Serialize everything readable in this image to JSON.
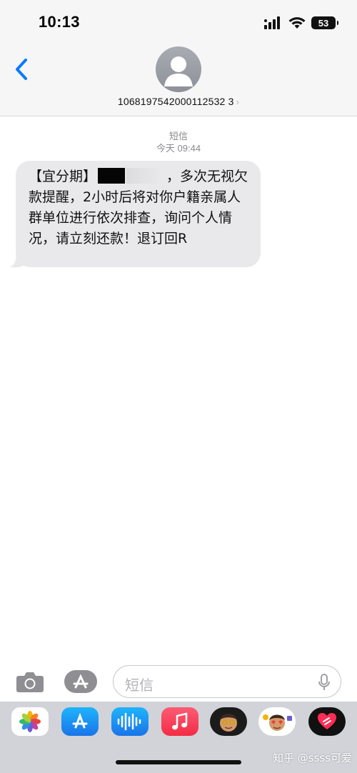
{
  "status_bar": {
    "time": "10:13",
    "battery_level": "53"
  },
  "header": {
    "contact_number": "1068197542000112532 3",
    "chevron": "›"
  },
  "thread": {
    "service_label": "短信",
    "timestamp": "今天 09:44",
    "message": {
      "part1": "【宜分期】",
      "part2": "，多次无视欠款提醒，2小时后将对你户籍亲属人群单位进行依次排查，询问个人情况，请立刻还款！退订回R"
    }
  },
  "compose": {
    "placeholder": "短信"
  },
  "app_drawer": {
    "apps": [
      "photos-app",
      "app-store-app",
      "audio-message-app",
      "music-app",
      "memoji-app",
      "memoji-stickers-app",
      "digital-touch-app"
    ]
  },
  "watermark": "知乎 @ssss可爱",
  "colors": {
    "accent": "#0a7aff",
    "bubble": "#e9e9eb",
    "header_bg": "#f6f6f6",
    "drawer_bg": "#d1d3d9"
  }
}
